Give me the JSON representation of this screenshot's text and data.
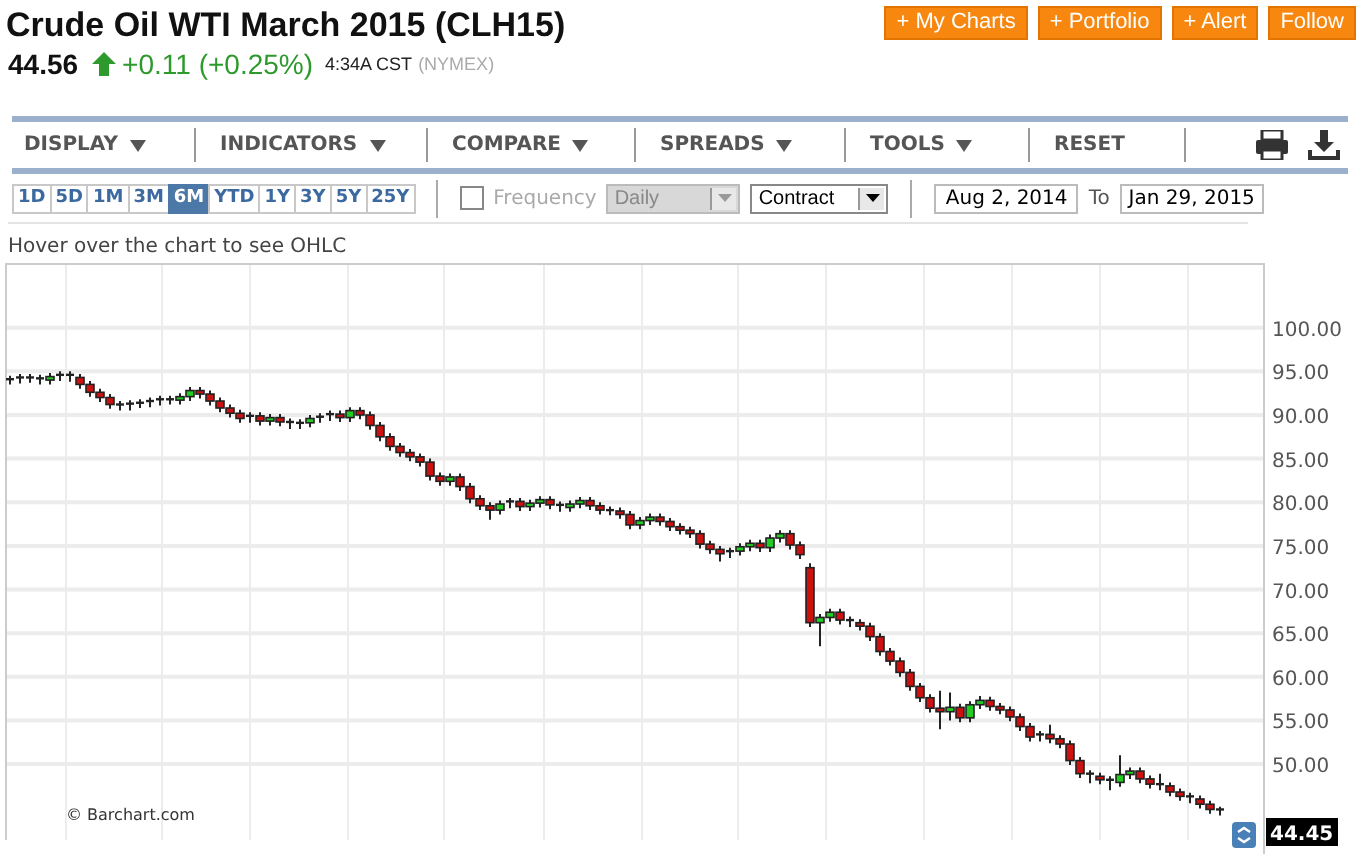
{
  "title": "Crude Oil WTI March 2015 (CLH15)",
  "quote": {
    "last": "44.56",
    "change": "+0.11 (+0.25%)",
    "time": "4:34A CST",
    "exchange": "(NYMEX)"
  },
  "actions": [
    "+ My Charts",
    "+ Portfolio",
    "+ Alert",
    "Follow"
  ],
  "menu": [
    {
      "label": "DISPLAY",
      "dropdown": true
    },
    {
      "label": "INDICATORS",
      "dropdown": true
    },
    {
      "label": "COMPARE",
      "dropdown": true
    },
    {
      "label": "SPREADS",
      "dropdown": true
    },
    {
      "label": "TOOLS",
      "dropdown": true
    },
    {
      "label": "RESET",
      "dropdown": false
    }
  ],
  "ranges": [
    {
      "label": "1D",
      "selected": false
    },
    {
      "label": "5D",
      "selected": false
    },
    {
      "label": "1M",
      "selected": false
    },
    {
      "label": "3M",
      "selected": false
    },
    {
      "label": "6M",
      "selected": true
    },
    {
      "label": "YTD",
      "selected": false
    },
    {
      "label": "1Y",
      "selected": false
    },
    {
      "label": "3Y",
      "selected": false
    },
    {
      "label": "5Y",
      "selected": false
    },
    {
      "label": "25Y",
      "selected": false
    }
  ],
  "frequency": {
    "label": "Frequency",
    "checked": false,
    "value": "Daily",
    "disabled": true
  },
  "contract": "Contract",
  "date_from": "Aug 2, 2014",
  "to_label": "To",
  "date_to": "Jan 29, 2015",
  "hint": "Hover over the chart to see OHLC",
  "chart": {
    "credit": "© Barchart.com",
    "last_label": "44.45",
    "chart_data": {
      "type": "candlestick",
      "grid": true,
      "ylim": [
        41.3,
        107.3
      ],
      "yticks": [
        {
          "value": 50,
          "label": "50.00"
        },
        {
          "value": 55,
          "label": "55.00"
        },
        {
          "value": 60,
          "label": "60.00"
        },
        {
          "value": 65,
          "label": "65.00"
        },
        {
          "value": 70,
          "label": "70.00"
        },
        {
          "value": 75,
          "label": "75.00"
        },
        {
          "value": 80,
          "label": "80.00"
        },
        {
          "value": 85,
          "label": "85.00"
        },
        {
          "value": 90,
          "label": "90.00"
        },
        {
          "value": 95,
          "label": "95.00"
        },
        {
          "value": 100,
          "label": "100.00"
        }
      ],
      "ohlc": [
        [
          94.0,
          94.5,
          93.5,
          94.1
        ],
        [
          94.1,
          94.7,
          93.6,
          94.3
        ],
        [
          94.3,
          94.7,
          93.7,
          94.2
        ],
        [
          94.2,
          94.6,
          93.5,
          94.0
        ],
        [
          94.0,
          94.8,
          93.5,
          94.4
        ],
        [
          94.4,
          95.0,
          93.9,
          94.6
        ],
        [
          94.6,
          95.0,
          93.8,
          94.3
        ],
        [
          94.3,
          94.7,
          93.0,
          93.5
        ],
        [
          93.5,
          93.9,
          92.1,
          92.6
        ],
        [
          92.6,
          93.0,
          91.5,
          92.0
        ],
        [
          92.0,
          92.4,
          90.7,
          91.2
        ],
        [
          91.2,
          91.6,
          90.5,
          91.0
        ],
        [
          91.0,
          91.7,
          90.5,
          91.3
        ],
        [
          91.3,
          91.8,
          90.8,
          91.4
        ],
        [
          91.4,
          92.0,
          90.9,
          91.6
        ],
        [
          91.6,
          92.2,
          91.1,
          91.8
        ],
        [
          91.8,
          92.2,
          91.2,
          91.7
        ],
        [
          91.7,
          92.5,
          91.2,
          92.1
        ],
        [
          92.1,
          93.2,
          91.6,
          92.8
        ],
        [
          92.8,
          93.2,
          91.9,
          92.4
        ],
        [
          92.4,
          92.8,
          91.1,
          91.6
        ],
        [
          91.6,
          92.0,
          90.3,
          90.8
        ],
        [
          90.8,
          91.2,
          89.7,
          90.2
        ],
        [
          90.2,
          90.6,
          89.1,
          89.6
        ],
        [
          89.6,
          90.3,
          89.1,
          89.9
        ],
        [
          89.9,
          90.3,
          88.8,
          89.3
        ],
        [
          89.3,
          90.1,
          88.8,
          89.7
        ],
        [
          89.7,
          90.1,
          88.7,
          89.2
        ],
        [
          89.2,
          89.6,
          88.4,
          88.9
        ],
        [
          88.9,
          89.5,
          88.4,
          89.1
        ],
        [
          89.1,
          90.0,
          88.6,
          89.6
        ],
        [
          89.6,
          90.2,
          89.1,
          89.8
        ],
        [
          89.8,
          90.5,
          89.3,
          90.1
        ],
        [
          90.1,
          90.5,
          89.2,
          89.7
        ],
        [
          89.7,
          90.9,
          89.2,
          90.5
        ],
        [
          90.5,
          90.9,
          89.5,
          90.0
        ],
        [
          90.0,
          90.4,
          88.3,
          88.8
        ],
        [
          88.8,
          89.2,
          87.0,
          87.5
        ],
        [
          87.5,
          87.9,
          85.9,
          86.4
        ],
        [
          86.4,
          86.8,
          85.2,
          85.7
        ],
        [
          85.7,
          86.1,
          84.7,
          85.2
        ],
        [
          85.2,
          85.6,
          84.1,
          84.6
        ],
        [
          84.6,
          85.0,
          82.5,
          83.0
        ],
        [
          83.0,
          83.4,
          81.9,
          82.4
        ],
        [
          82.4,
          83.3,
          81.9,
          82.9
        ],
        [
          82.9,
          83.3,
          81.3,
          81.8
        ],
        [
          81.8,
          82.2,
          79.9,
          80.4
        ],
        [
          80.4,
          80.8,
          79.1,
          79.6
        ],
        [
          79.6,
          80.0,
          78.0,
          79.1
        ],
        [
          79.1,
          80.2,
          78.6,
          79.8
        ],
        [
          79.8,
          80.5,
          79.3,
          80.1
        ],
        [
          80.1,
          80.5,
          79.0,
          79.5
        ],
        [
          79.5,
          80.3,
          79.0,
          79.9
        ],
        [
          79.9,
          80.7,
          79.4,
          80.3
        ],
        [
          80.3,
          80.7,
          79.2,
          79.7
        ],
        [
          79.7,
          80.1,
          78.9,
          79.4
        ],
        [
          79.4,
          80.2,
          78.9,
          79.8
        ],
        [
          79.8,
          80.6,
          79.3,
          80.2
        ],
        [
          80.2,
          80.6,
          79.1,
          79.6
        ],
        [
          79.6,
          80.0,
          78.6,
          79.1
        ],
        [
          79.1,
          79.5,
          78.5,
          79.0
        ],
        [
          79.0,
          79.4,
          78.1,
          78.6
        ],
        [
          78.6,
          79.0,
          76.9,
          77.4
        ],
        [
          77.4,
          78.3,
          76.9,
          77.9
        ],
        [
          77.9,
          78.7,
          77.4,
          78.3
        ],
        [
          78.3,
          78.7,
          77.3,
          77.8
        ],
        [
          77.8,
          78.2,
          76.7,
          77.2
        ],
        [
          77.2,
          77.6,
          76.3,
          76.8
        ],
        [
          76.8,
          77.2,
          75.9,
          76.4
        ],
        [
          76.4,
          76.8,
          74.7,
          75.2
        ],
        [
          75.2,
          75.6,
          74.1,
          74.6
        ],
        [
          74.6,
          75.0,
          73.2,
          74.1
        ],
        [
          74.1,
          74.8,
          73.6,
          74.4
        ],
        [
          74.4,
          75.3,
          73.9,
          74.9
        ],
        [
          74.9,
          75.7,
          74.4,
          75.3
        ],
        [
          75.3,
          75.7,
          74.3,
          74.8
        ],
        [
          74.8,
          76.3,
          74.3,
          75.9
        ],
        [
          75.9,
          76.8,
          75.4,
          76.4
        ],
        [
          76.4,
          76.8,
          74.6,
          75.1
        ],
        [
          75.1,
          75.5,
          73.5,
          74.0
        ],
        [
          72.5,
          73.0,
          65.7,
          66.2
        ],
        [
          66.2,
          67.2,
          63.5,
          66.8
        ],
        [
          66.8,
          67.8,
          66.3,
          67.4
        ],
        [
          67.4,
          67.8,
          66.0,
          66.5
        ],
        [
          66.5,
          66.9,
          65.7,
          66.2
        ],
        [
          66.2,
          66.6,
          65.3,
          65.8
        ],
        [
          65.8,
          66.2,
          64.1,
          64.6
        ],
        [
          64.6,
          65.0,
          62.4,
          62.9
        ],
        [
          62.9,
          63.3,
          61.3,
          61.8
        ],
        [
          61.8,
          62.2,
          60.0,
          60.5
        ],
        [
          60.5,
          60.9,
          58.4,
          58.9
        ],
        [
          58.9,
          59.3,
          57.1,
          57.6
        ],
        [
          57.6,
          58.0,
          55.9,
          56.4
        ],
        [
          56.4,
          58.4,
          54.0,
          56.0
        ],
        [
          56.0,
          58.2,
          55.0,
          56.5
        ],
        [
          56.5,
          56.9,
          54.8,
          55.3
        ],
        [
          55.3,
          57.2,
          54.8,
          56.8
        ],
        [
          56.8,
          57.8,
          56.3,
          57.3
        ],
        [
          57.3,
          57.7,
          56.1,
          56.6
        ],
        [
          56.6,
          57.0,
          55.7,
          56.2
        ],
        [
          56.2,
          56.6,
          54.9,
          55.4
        ],
        [
          55.4,
          55.8,
          53.8,
          54.3
        ],
        [
          54.3,
          54.7,
          52.6,
          53.1
        ],
        [
          53.1,
          53.8,
          52.6,
          53.4
        ],
        [
          53.4,
          54.5,
          52.4,
          52.9
        ],
        [
          52.9,
          53.3,
          51.8,
          52.3
        ],
        [
          52.3,
          52.7,
          49.9,
          50.4
        ],
        [
          50.4,
          50.8,
          48.4,
          48.9
        ],
        [
          48.9,
          49.3,
          47.8,
          48.6
        ],
        [
          48.6,
          49.0,
          47.7,
          48.2
        ],
        [
          48.2,
          48.6,
          47.0,
          47.9
        ],
        [
          47.9,
          51.0,
          47.4,
          48.8
        ],
        [
          48.8,
          49.6,
          48.3,
          49.2
        ],
        [
          49.2,
          49.6,
          47.8,
          48.3
        ],
        [
          48.3,
          48.7,
          47.2,
          47.7
        ],
        [
          47.7,
          48.9,
          47.0,
          47.5
        ],
        [
          47.5,
          47.9,
          46.3,
          46.8
        ],
        [
          46.8,
          47.2,
          45.8,
          46.3
        ],
        [
          46.3,
          46.7,
          45.5,
          46.0
        ],
        [
          46.0,
          46.4,
          44.9,
          45.4
        ],
        [
          45.4,
          45.8,
          44.3,
          44.8
        ],
        [
          44.8,
          45.1,
          44.1,
          44.5
        ]
      ]
    }
  }
}
